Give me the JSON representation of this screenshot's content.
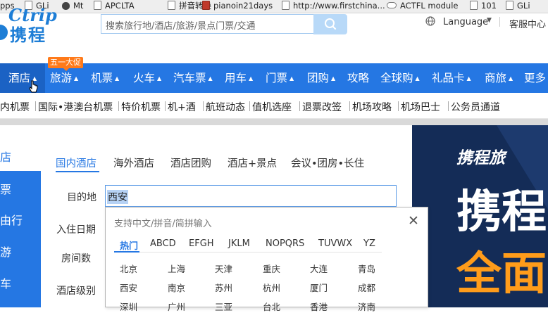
{
  "bookmarks": [
    {
      "label": "pps",
      "icon": "none"
    },
    {
      "label": "GLi",
      "icon": "page-icon"
    },
    {
      "label": "Mt",
      "icon": "g-icon"
    },
    {
      "label": "APCLTA",
      "icon": "page-icon"
    },
    {
      "label": "拼音转换",
      "icon": "page-icon"
    },
    {
      "label": "pianoin21days",
      "icon": "red-icon"
    },
    {
      "label": "http://www.firstchina...",
      "icon": "page-icon"
    },
    {
      "label": "ACTFL module",
      "icon": "cloud-icon"
    },
    {
      "label": "101",
      "icon": "page-icon"
    },
    {
      "label": "GLi",
      "icon": "page-icon"
    }
  ],
  "header": {
    "logo_en": "Ctrip",
    "logo_cn": "携程",
    "search_placeholder": "搜索旅行地/酒店/旅游/景点门票/交通",
    "language_label": "Language",
    "service_label": "客服中心"
  },
  "nav": {
    "promo_badge": "五一大促",
    "items": [
      {
        "label": "酒店",
        "has_caret": true
      },
      {
        "label": "旅游",
        "has_caret": true
      },
      {
        "label": "机票",
        "has_caret": true
      },
      {
        "label": "火车",
        "has_caret": true
      },
      {
        "label": "汽车票",
        "has_caret": true
      },
      {
        "label": "用车",
        "has_caret": true
      },
      {
        "label": "门票",
        "has_caret": true
      },
      {
        "label": "团购",
        "has_caret": true
      },
      {
        "label": "攻略",
        "has_caret": false
      },
      {
        "label": "全球购",
        "has_caret": true
      },
      {
        "label": "礼品卡",
        "has_caret": true
      },
      {
        "label": "商旅",
        "has_caret": true
      },
      {
        "label": "更多",
        "has_caret": false
      }
    ]
  },
  "subnav": {
    "items": [
      "内机票",
      "国际•港澳台机票",
      "特价机票",
      "机+酒",
      "航班动态",
      "值机选座",
      "退票改签",
      "机场攻略",
      "机场巴士",
      "公务员通道"
    ]
  },
  "left_column": {
    "items": [
      "店",
      "票",
      "由行",
      "游",
      "车"
    ]
  },
  "panel": {
    "tabs": [
      "国内酒店",
      "海外酒店",
      "酒店团购",
      "酒店+景点",
      "会议•团房•长住"
    ],
    "active_tab": "国内酒店",
    "labels": {
      "destination": "目的地",
      "checkin": "入住日期",
      "rooms": "房间数",
      "star": "酒店级别"
    },
    "destination_value": "西安"
  },
  "dropdown": {
    "hint": "支持中文/拼音/简拼输入",
    "close_glyph": "✕",
    "tabs": [
      "热门",
      "ABCD",
      "EFGH",
      "JKLM",
      "NOPQRS",
      "TUVWX",
      "YZ"
    ],
    "active_tab": "热门",
    "cities": [
      [
        "北京",
        "上海",
        "天津",
        "重庆",
        "大连",
        "青岛"
      ],
      [
        "西安",
        "南京",
        "苏州",
        "杭州",
        "厦门",
        "成都"
      ],
      [
        "深圳",
        "广州",
        "三亚",
        "台北",
        "香港",
        "济南"
      ]
    ]
  },
  "banner": {
    "logo_text": "携程旅",
    "big_text_1": "携程",
    "big_text_2": "全面"
  },
  "colors": {
    "brand_blue": "#2577e3",
    "promo_orange": "#ff7a1a",
    "banner_navy": "#142c57",
    "banner_orange": "#ff9c1a"
  }
}
